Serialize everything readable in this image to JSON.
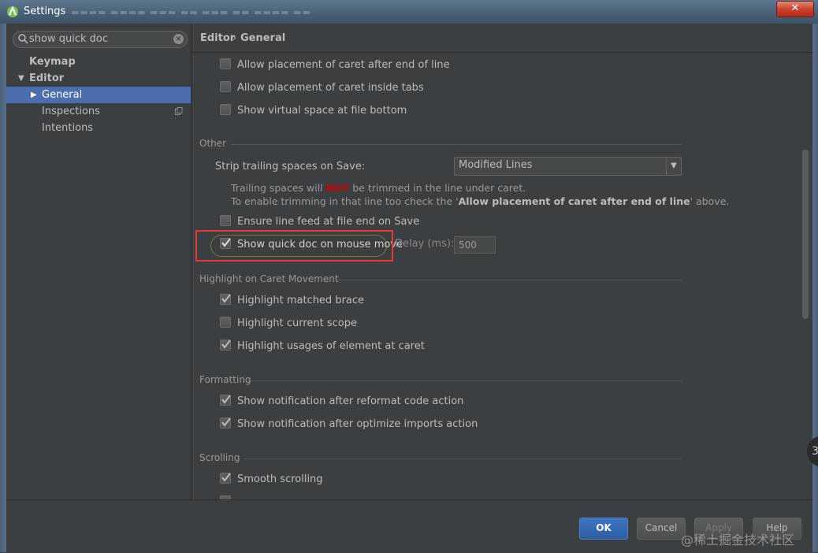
{
  "window": {
    "title": "Settings",
    "close_label": "✕"
  },
  "search": {
    "value": "show quick doc"
  },
  "tree": {
    "items": [
      {
        "label": "Keymap"
      },
      {
        "label": "Editor"
      },
      {
        "label": "General"
      },
      {
        "label": "Inspections"
      },
      {
        "label": "Intentions"
      }
    ]
  },
  "breadcrumb": {
    "part1": "Editor",
    "separator": "›",
    "part2": "General"
  },
  "caret": {
    "items": [
      {
        "label": "Allow placement of caret after end of line",
        "checked": false
      },
      {
        "label": "Allow placement of caret inside tabs",
        "checked": false
      },
      {
        "label": "Show virtual space at file bottom",
        "checked": false
      }
    ]
  },
  "other": {
    "title": "Other",
    "strip_label": "Strip trailing spaces on Save:",
    "strip_value": "Modified Lines",
    "hint_line1_a": "Trailing spaces will ",
    "hint_line1_not": "NOT",
    "hint_line1_b": " be trimmed in the line under caret.",
    "hint_line2_a": "To enable trimming in that line too check the '",
    "hint_line2_bold": "Allow placement of caret after end of line",
    "hint_line2_b": "' above.",
    "ensure_label": "Ensure line feed at file end on Save",
    "quickdoc_label": "Show quick doc on mouse move",
    "delay_label": "Delay (ms):",
    "delay_value": "500"
  },
  "highlight": {
    "title": "Highlight on Caret Movement",
    "items": [
      {
        "label": "Highlight matched brace",
        "checked": true
      },
      {
        "label": "Highlight current scope",
        "checked": false
      },
      {
        "label": "Highlight usages of element at caret",
        "checked": true
      }
    ]
  },
  "formatting": {
    "title": "Formatting",
    "items": [
      {
        "label": "Show notification after reformat code action",
        "checked": true
      },
      {
        "label": "Show notification after optimize imports action",
        "checked": true
      }
    ]
  },
  "scrolling": {
    "title": "Scrolling",
    "items": [
      {
        "label": "Smooth scrolling",
        "checked": true
      }
    ]
  },
  "buttons": {
    "ok": "OK",
    "cancel": "Cancel",
    "apply": "Apply",
    "help": "Help"
  },
  "watermark": "@稀土掘金技术社区"
}
